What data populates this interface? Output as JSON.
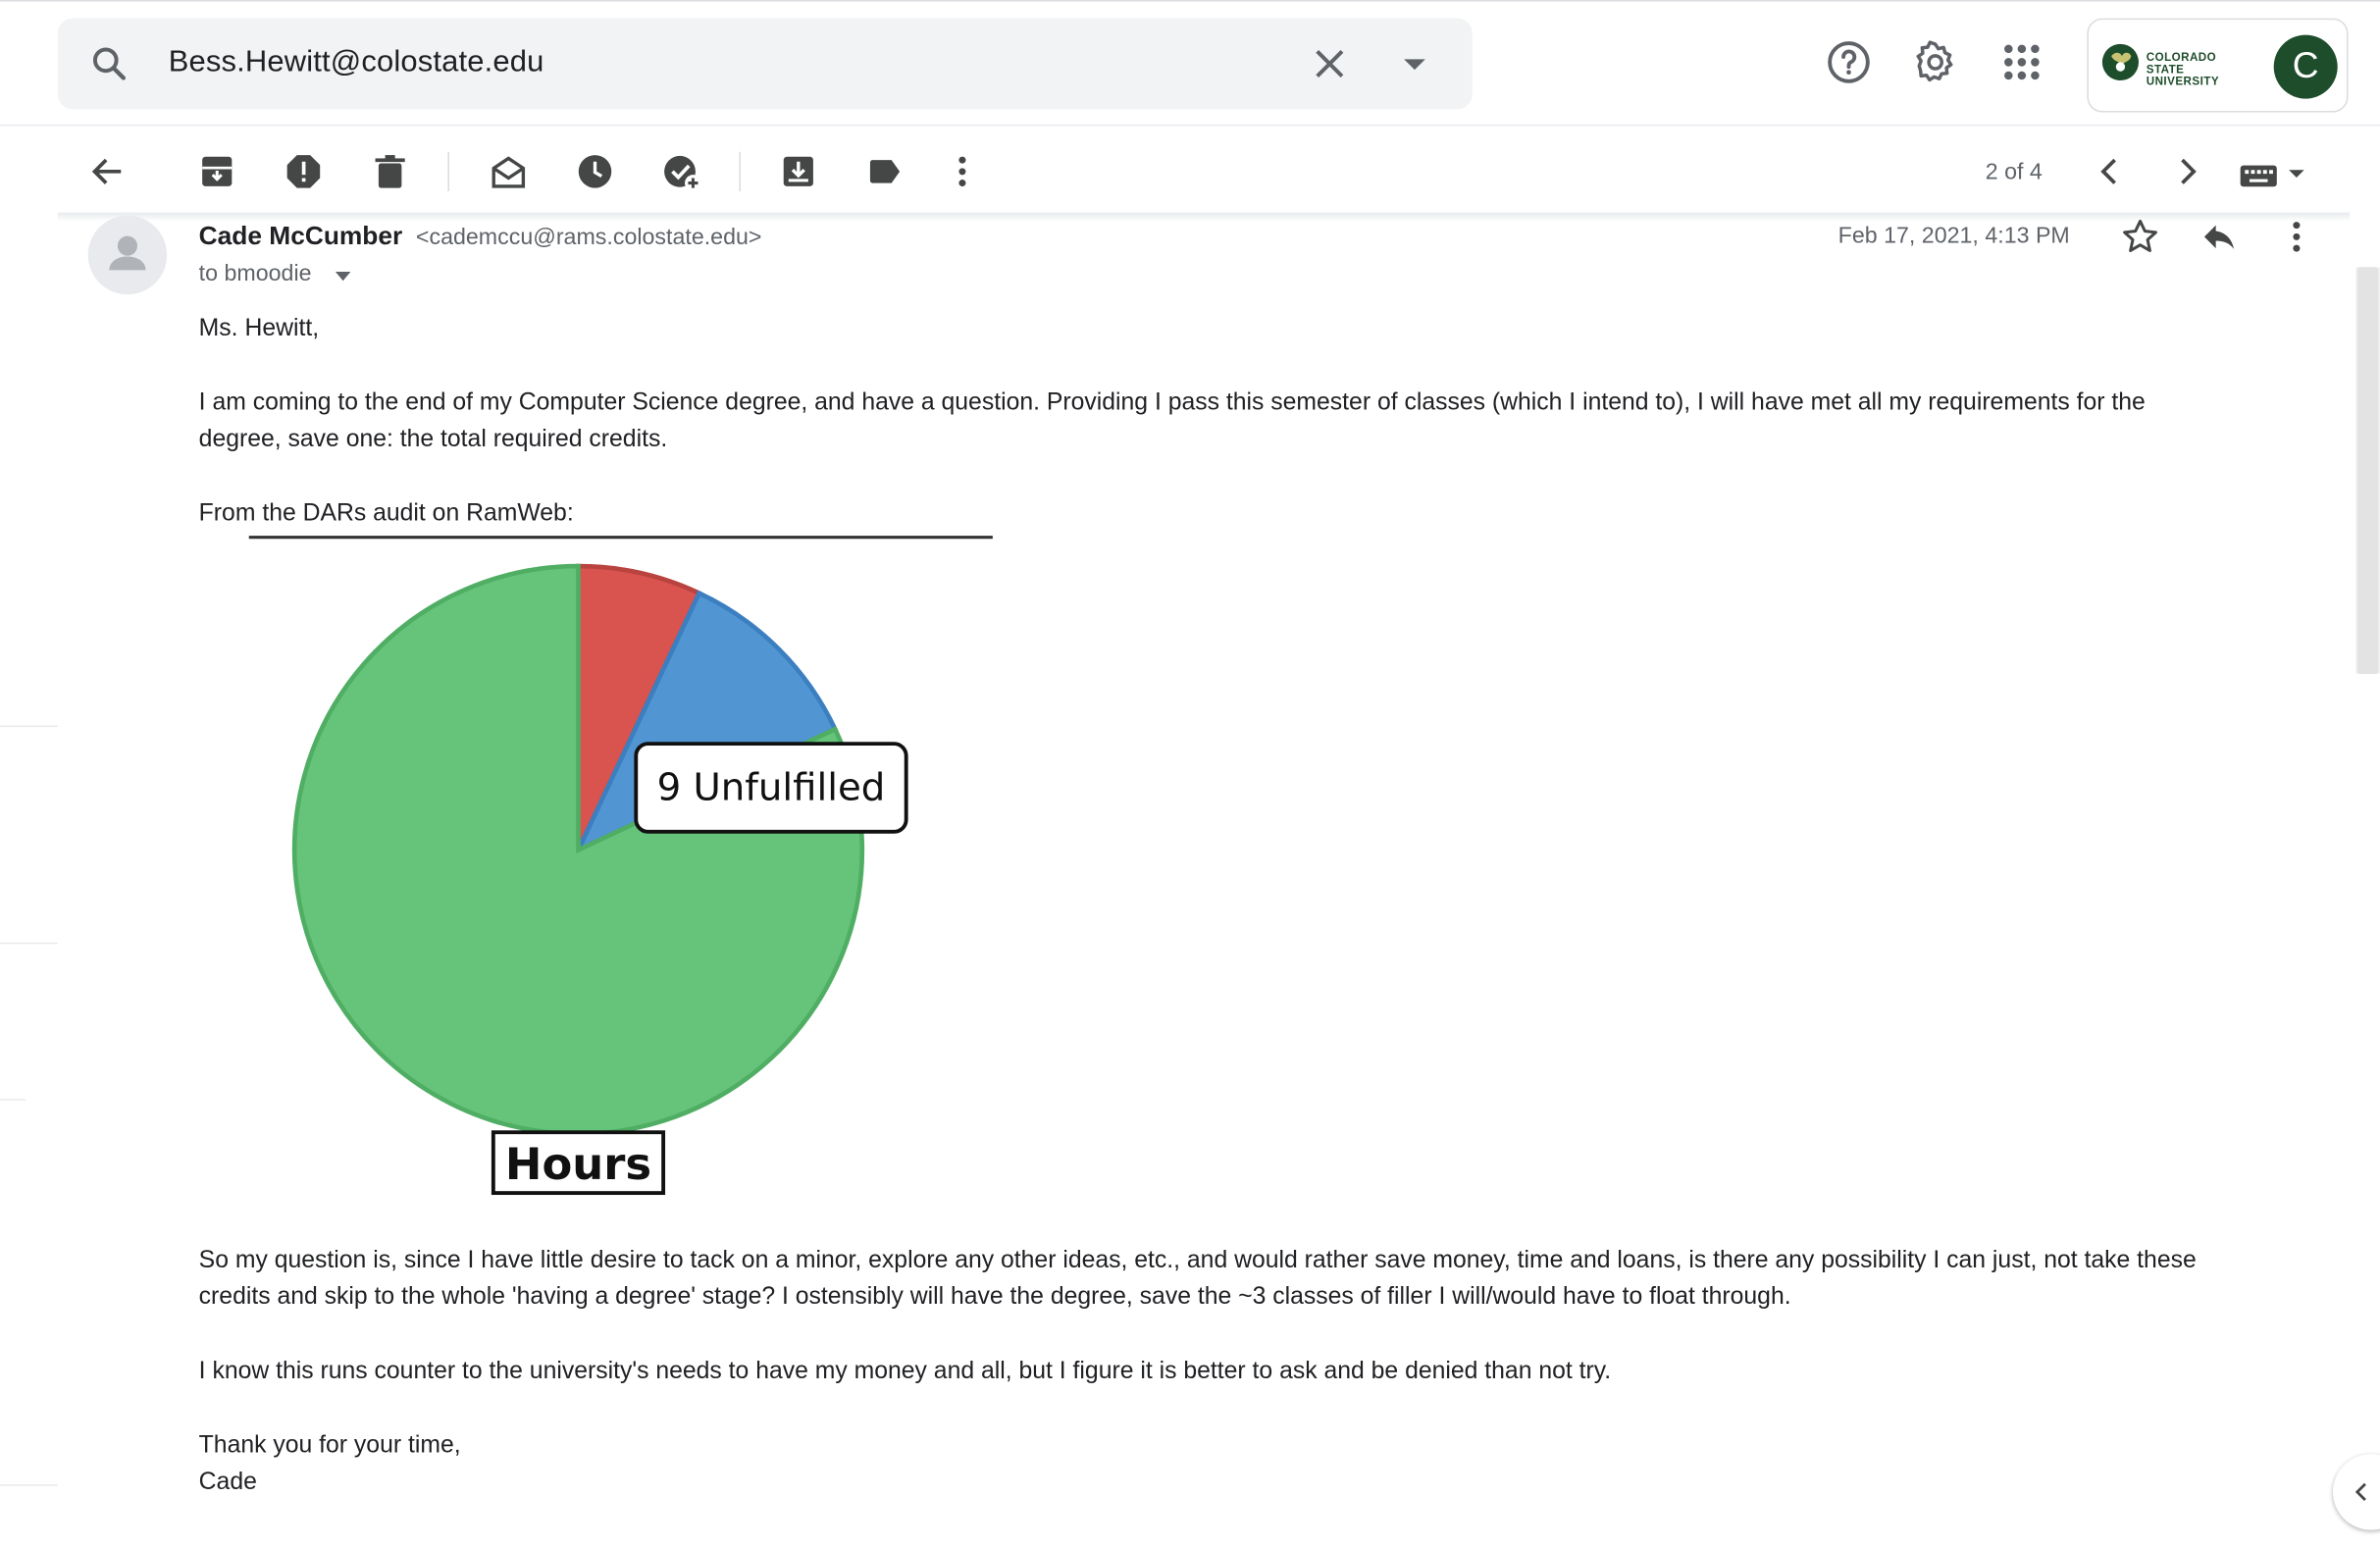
{
  "search": {
    "value": "Bess.Hewitt@colostate.edu"
  },
  "header": {
    "university_logo_text_line1": "COLORADO STATE",
    "university_logo_text_line2": "UNIVERSITY",
    "avatar_letter": "C",
    "icons": [
      "search-icon",
      "clear-search-icon",
      "search-options-icon",
      "help-icon",
      "settings-icon",
      "apps-icon"
    ]
  },
  "toolbar": {
    "icons": [
      "back-icon",
      "archive-icon",
      "report-spam-icon",
      "delete-icon",
      "mark-unread-icon",
      "snooze-icon",
      "add-to-tasks-icon",
      "move-to-icon",
      "label-icon",
      "more-icon"
    ],
    "pager": "2 of 4"
  },
  "message": {
    "sender_name": "Cade McCumber",
    "sender_email": "<cademccu@rams.colostate.edu>",
    "to": "to bmoodie",
    "date": "Feb 17, 2021, 4:13 PM",
    "greeting": "Ms. Hewitt,",
    "para1_line1": "I am coming to the end of my Computer Science degree, and have a question. Providing I pass this semester of classes (which I intend to), I will have met all my requirements for the",
    "para1_line2": "degree, save one: the total required credits.",
    "audit_intro": "From the DARs audit on RamWeb:",
    "para2_line1": "So my question is, since I have little desire to tack on a minor, explore any other ideas, etc., and would rather save money, time and loans, is there any possibility I can just, not take these",
    "para2_line2": "credits and skip to the whole 'having a degree' stage? I ostensibly will have the degree, save the ~3 classes of filler I will/would have to float through.",
    "para3": "I know this runs counter to the university's needs to have my money and all, but I figure it is better to ask and be denied than not try.",
    "closing": "Thank you for your time,",
    "signature": "Cade"
  },
  "chart_data": {
    "type": "pie",
    "title": "",
    "labels": [
      "",
      "",
      ""
    ],
    "values": [
      0.07,
      0.11,
      0.82
    ],
    "colors": [
      "#d9534f",
      "#5195d3",
      "#66c47a"
    ],
    "annotations": [
      "9 Unfulfilled"
    ],
    "caption": "Hours"
  }
}
